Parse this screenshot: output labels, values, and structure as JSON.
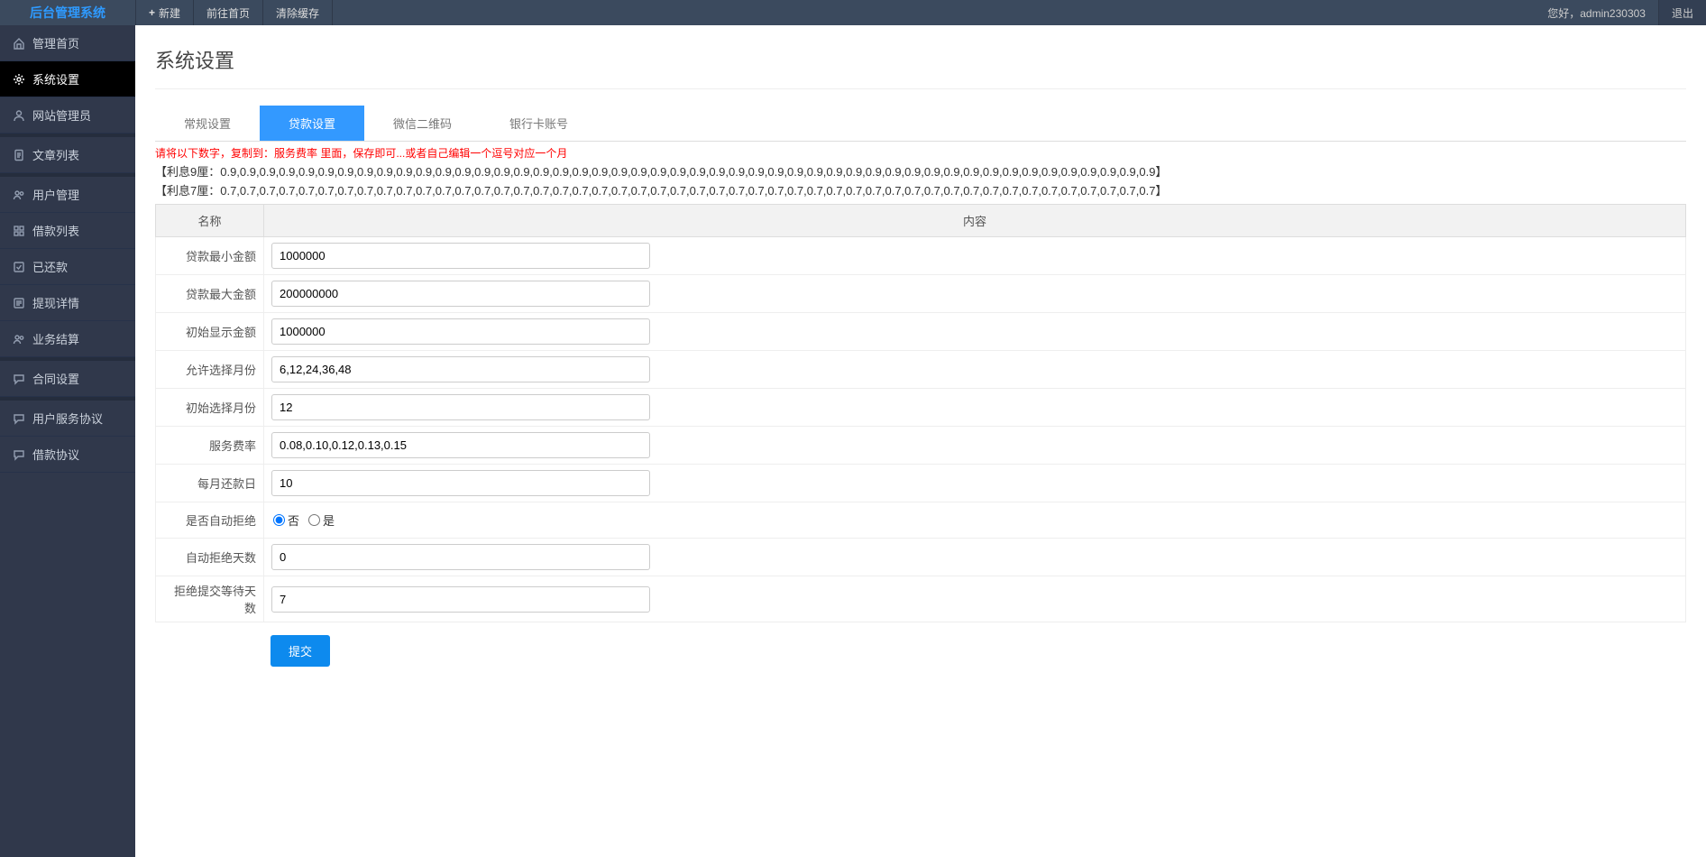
{
  "brand": "后台管理系统",
  "top": {
    "new": "新建",
    "home": "前往首页",
    "clear": "清除缓存",
    "greeting": "您好，admin230303",
    "logout": "退出"
  },
  "sidebar": [
    {
      "key": "dashboard",
      "label": "管理首页",
      "icon": "home"
    },
    {
      "key": "system",
      "label": "系统设置",
      "icon": "gear",
      "active": true
    },
    {
      "key": "admin",
      "label": "网站管理员",
      "icon": "user",
      "gapAfter": true
    },
    {
      "key": "articles",
      "label": "文章列表",
      "icon": "doc",
      "gapAfter": true
    },
    {
      "key": "users",
      "label": "用户管理",
      "icon": "users"
    },
    {
      "key": "loans",
      "label": "借款列表",
      "icon": "grid"
    },
    {
      "key": "repaid",
      "label": "已还款",
      "icon": "check"
    },
    {
      "key": "withdraw",
      "label": "提现详情",
      "icon": "list"
    },
    {
      "key": "settle",
      "label": "业务结算",
      "icon": "users",
      "gapAfter": true
    },
    {
      "key": "contract",
      "label": "合同设置",
      "icon": "chat",
      "gapAfter": true
    },
    {
      "key": "useragree",
      "label": "用户服务协议",
      "icon": "chat"
    },
    {
      "key": "loanagree",
      "label": "借款协议",
      "icon": "chat"
    }
  ],
  "page_title": "系统设置",
  "tabs": [
    {
      "key": "general",
      "label": "常规设置"
    },
    {
      "key": "loan",
      "label": "贷款设置",
      "active": true
    },
    {
      "key": "wechat",
      "label": "微信二维码"
    },
    {
      "key": "bank",
      "label": "银行卡账号"
    }
  ],
  "warn": "请将以下数字，复制到：服务费率 里面，保存即可...或者自己编辑一个逗号对应一个月",
  "info1": "【利息9厘：0.9,0.9,0.9,0.9,0.9,0.9,0.9,0.9,0.9,0.9,0.9,0.9,0.9,0.9,0.9,0.9,0.9,0.9,0.9,0.9,0.9,0.9,0.9,0.9,0.9,0.9,0.9,0.9,0.9,0.9,0.9,0.9,0.9,0.9,0.9,0.9,0.9,0.9,0.9,0.9,0.9,0.9,0.9,0.9,0.9,0.9,0.9,0.9】",
  "info2": "【利息7厘：0.7,0.7,0.7,0.7,0.7,0.7,0.7,0.7,0.7,0.7,0.7,0.7,0.7,0.7,0.7,0.7,0.7,0.7,0.7,0.7,0.7,0.7,0.7,0.7,0.7,0.7,0.7,0.7,0.7,0.7,0.7,0.7,0.7,0.7,0.7,0.7,0.7,0.7,0.7,0.7,0.7,0.7,0.7,0.7,0.7,0.7,0.7,0.7】",
  "th_name": "名称",
  "th_content": "内容",
  "fields": {
    "min_amount": {
      "label": "贷款最小金额",
      "value": "1000000"
    },
    "max_amount": {
      "label": "贷款最大金额",
      "value": "200000000"
    },
    "init_amount": {
      "label": "初始显示金额",
      "value": "1000000"
    },
    "allow_months": {
      "label": "允许选择月份",
      "value": "6,12,24,36,48"
    },
    "init_month": {
      "label": "初始选择月份",
      "value": "12"
    },
    "fee_rate": {
      "label": "服务费率",
      "value": "0.08,0.10,0.12,0.13,0.15"
    },
    "repay_day": {
      "label": "每月还款日",
      "value": "10"
    },
    "auto_reject": {
      "label": "是否自动拒绝",
      "opt_no": "否",
      "opt_yes": "是",
      "selected": "no"
    },
    "reject_days": {
      "label": "自动拒绝天数",
      "value": "0"
    },
    "wait_days": {
      "label": "拒绝提交等待天数",
      "value": "7"
    }
  },
  "submit": "提交"
}
